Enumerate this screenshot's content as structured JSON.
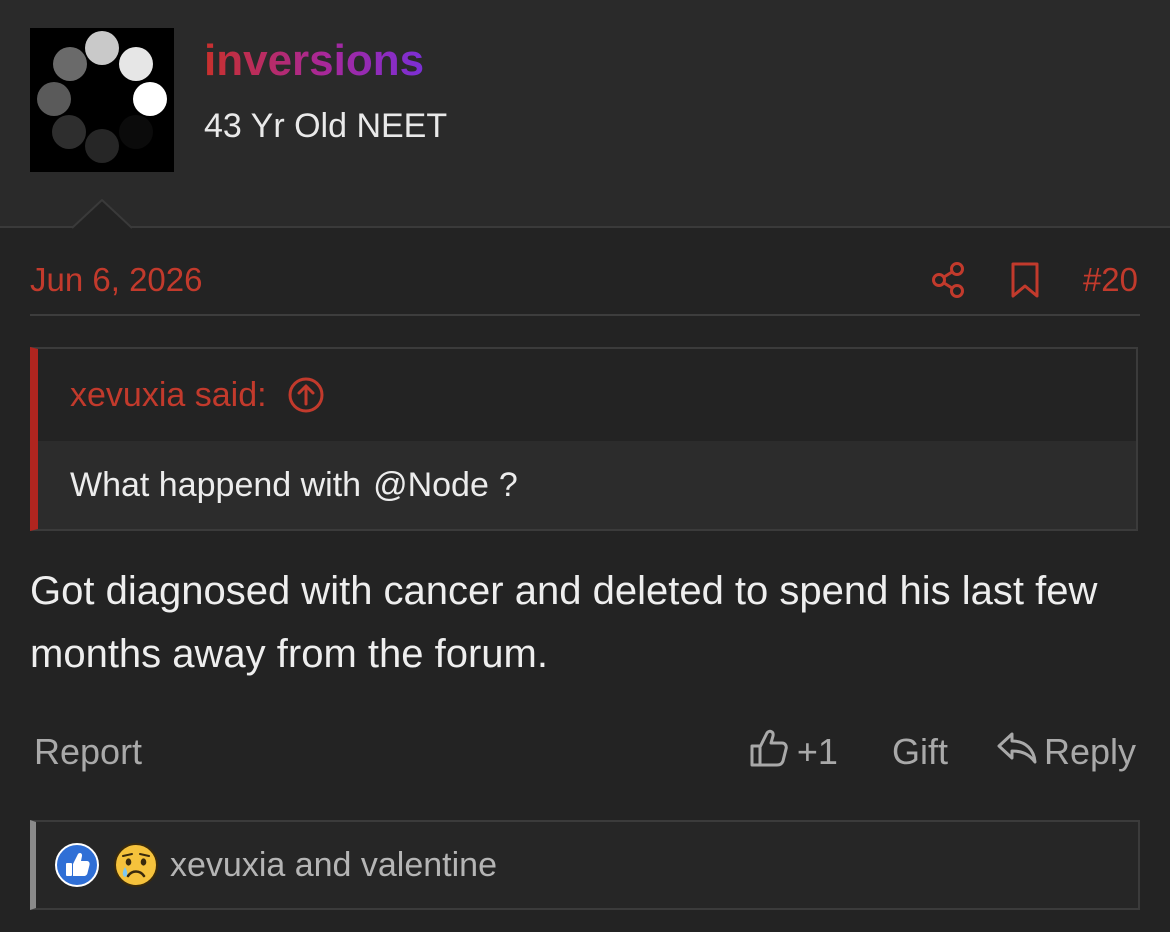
{
  "author": {
    "username": "inversions",
    "user_title": "43 Yr Old NEET",
    "avatar": "loading-spinner-avatar"
  },
  "post": {
    "date": "Jun 6, 2026",
    "number": "#20",
    "message": "Got diagnosed with cancer and deleted to spend his last few months away from the forum."
  },
  "quote": {
    "author_said": "xevuxia said:",
    "body_text": "What happend with",
    "mention": "@Node",
    "body_end": "?"
  },
  "actions": {
    "report": "Report",
    "like_count": "+1",
    "gift": "Gift",
    "reply": "Reply"
  },
  "reactions": {
    "users": "xevuxia and valentine",
    "icons": [
      "like-reaction-icon",
      "sad-reaction-icon"
    ]
  },
  "colors": {
    "accent": "#c23a2c",
    "username_gradient": [
      "#c8302c",
      "#a8289a",
      "#7b2fd6"
    ],
    "background": "#232323",
    "quote_bar": "#b0251f"
  },
  "icons": [
    "share-icon",
    "bookmark-icon",
    "scroll-up-circle-icon",
    "thumbs-up-icon",
    "reply-arrow-icon"
  ]
}
